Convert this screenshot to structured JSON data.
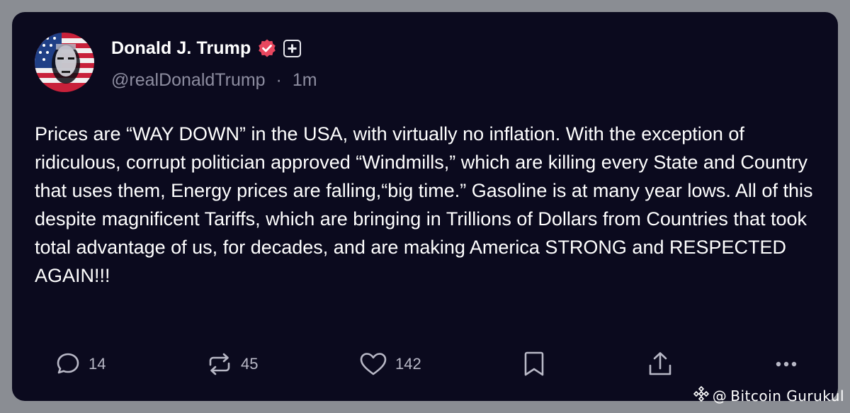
{
  "post": {
    "author_name": "Donald J. Trump",
    "handle": "@realDonaldTrump",
    "separator": "·",
    "time": "1m",
    "text": "Prices are “WAY DOWN” in the USA, with virtually no inflation. With the exception of ridiculous, corrupt politician approved “Windmills,” which are killing every State and Country that uses them, Energy prices are falling,“big time.” Gasoline is at many year lows. All of this despite magnificent Tariffs, which are bringing in Trillions of Dollars from Countries that took total advantage of us, for decades, and are making America STRONG and RESPECTED AGAIN!!!"
  },
  "actions": {
    "replies": "14",
    "reposts": "45",
    "likes": "142"
  },
  "icons": {
    "reply": "reply-icon",
    "repost": "repost-icon",
    "like": "heart-icon",
    "bookmark": "bookmark-icon",
    "share": "share-icon",
    "more": "more-icon",
    "verified": "verified-badge-icon",
    "plus": "plus-badge-icon"
  },
  "watermark": {
    "at": "@",
    "text": "Bitcoin Gurukul"
  },
  "colors": {
    "card_background": "#0b0a1e",
    "page_background": "#8a8d93",
    "verified_badge": "#e8475f",
    "secondary_text": "#8d8da0"
  }
}
